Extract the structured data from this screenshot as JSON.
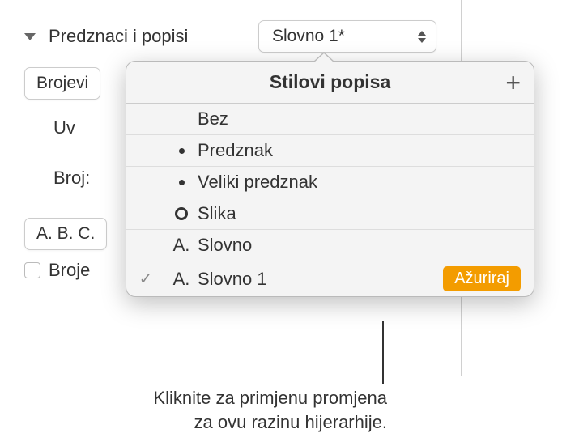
{
  "main": {
    "label_predznaci": "Predznaci i popisi",
    "dropdown_value": "Slovno 1*",
    "btn_brojevi": "Brojevi",
    "label_uv": "Uv",
    "label_broj": "Broj:",
    "btn_abc": "A. B. C.",
    "label_broje": "Broje"
  },
  "popover": {
    "title": "Stilovi popisa",
    "items": [
      {
        "bullet": "",
        "label": "Bez",
        "checked": false
      },
      {
        "bullet": "dot",
        "label": "Predznak",
        "checked": false
      },
      {
        "bullet": "dot",
        "label": "Veliki predznak",
        "checked": false
      },
      {
        "bullet": "ring",
        "label": "Slika",
        "checked": false
      },
      {
        "bullet": "A.",
        "label": "Slovno",
        "checked": false
      },
      {
        "bullet": "A.",
        "label": "Slovno 1",
        "checked": true,
        "action": "Ažuriraj"
      }
    ]
  },
  "callout": {
    "line1": "Kliknite za primjenu promjena",
    "line2": "za ovu razinu hijerarhije."
  }
}
